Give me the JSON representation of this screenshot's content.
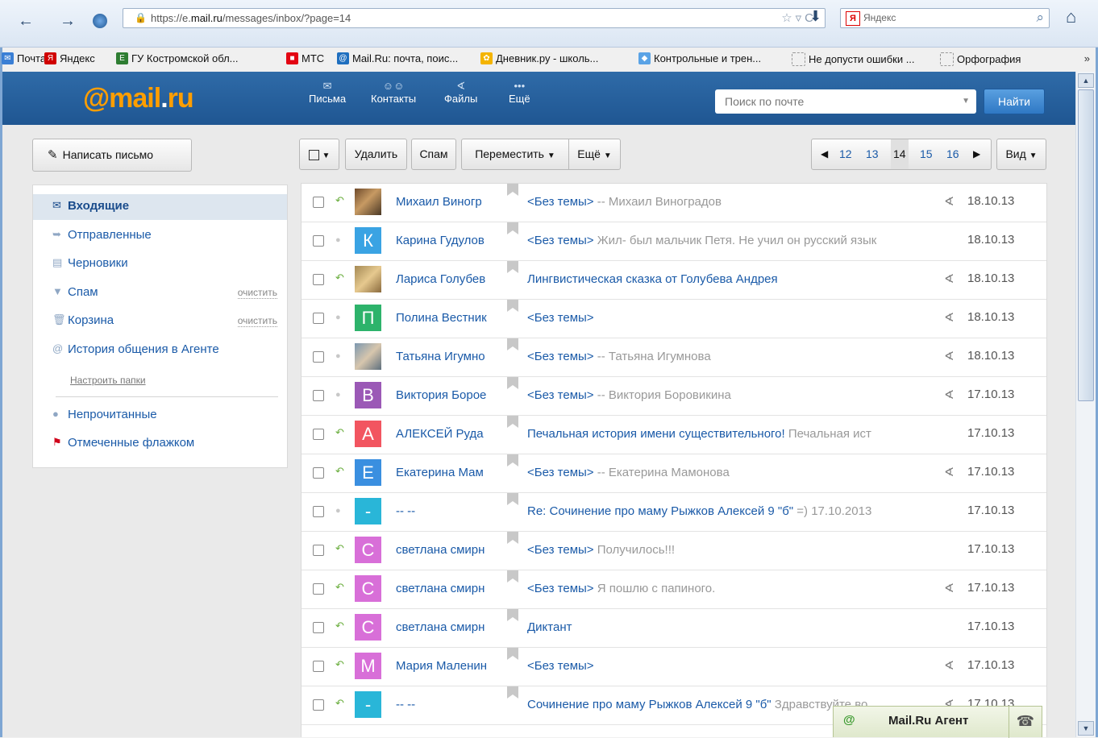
{
  "browser": {
    "url_prefix": "https://e.",
    "url_host": "mail.ru",
    "url_path": "/messages/inbox/?page=14",
    "search_engine_label": "Яндекс",
    "bookmarks": [
      {
        "label": "Почта",
        "icon": "mail-icon",
        "color": "#3a7fd5"
      },
      {
        "label": "Яндекс",
        "icon": "yandex-icon",
        "color": "#d00000"
      },
      {
        "label": "ГУ Костромской обл...",
        "icon": "ege-icon",
        "color": "#2e7d32"
      },
      {
        "label": "МТС",
        "icon": "mts-icon",
        "color": "#e30613"
      },
      {
        "label": "Mail.Ru: почта, поис...",
        "icon": "mailru-icon",
        "color": "#1f6fbf"
      },
      {
        "label": "Дневник.ру - школь...",
        "icon": "dnevnik-icon",
        "color": "#f4b400"
      },
      {
        "label": "Контрольные и трен...",
        "icon": "tests-icon",
        "color": "#5aa3e6"
      },
      {
        "label": "Не допусти ошибки ...",
        "icon": "page-icon",
        "color": "#999999"
      },
      {
        "label": "Орфография",
        "icon": "page-icon",
        "color": "#999999"
      }
    ],
    "more_label": "»"
  },
  "header": {
    "logo_at": "@",
    "logo_text": "mail",
    "logo_dot": ".",
    "logo_tld": "ru",
    "nav": [
      {
        "label": "Письма",
        "icon": "envelope-icon"
      },
      {
        "label": "Контакты",
        "icon": "contacts-icon"
      },
      {
        "label": "Файлы",
        "icon": "paperclip-icon"
      },
      {
        "label": "Ещё",
        "icon": "more-dots-icon"
      }
    ],
    "search_placeholder": "Поиск по почте",
    "search_button": "Найти"
  },
  "compose_label": "Написать письмо",
  "folders": [
    {
      "label": "Входящие",
      "icon": "envelope-icon",
      "action": ""
    },
    {
      "label": "Отправленные",
      "icon": "sent-icon",
      "action": ""
    },
    {
      "label": "Черновики",
      "icon": "draft-icon",
      "action": ""
    },
    {
      "label": "Спам",
      "icon": "thumbs-down-icon",
      "action": "очистить"
    },
    {
      "label": "Корзина",
      "icon": "trash-icon",
      "action": "очистить"
    },
    {
      "label": "История общения в Агенте",
      "icon": "at-icon",
      "action": ""
    }
  ],
  "setup_folders_label": "Настроить папки",
  "filters": [
    {
      "label": "Непрочитанные",
      "icon": "dot-icon"
    },
    {
      "label": "Отмеченные флажком",
      "icon": "flag-icon"
    }
  ],
  "toolbar": {
    "delete": "Удалить",
    "spam": "Спам",
    "move": "Переместить",
    "more": "Ещё",
    "view": "Вид"
  },
  "pager": {
    "pages": [
      "12",
      "13",
      "14",
      "15",
      "16"
    ],
    "current": "14"
  },
  "messages": [
    {
      "from": "Михаил Виногр",
      "subject": "<Без темы>",
      "snippet": " -- Михаил Виноградов",
      "date": "18.10.13",
      "attach": true,
      "status": "reply",
      "avatar": "photo",
      "letter": "",
      "color": ""
    },
    {
      "from": "Карина Гудулов",
      "subject": "<Без темы>",
      "snippet": " Жил- был мальчик Петя. Не учил он русский язык",
      "date": "18.10.13",
      "attach": false,
      "status": "dot",
      "avatar": "letter",
      "letter": "К",
      "color": "#3aa3e3"
    },
    {
      "from": "Лариса Голубев",
      "subject": "Лингвистическая сказка от Голубева Андрея",
      "snippet": "",
      "date": "18.10.13",
      "attach": true,
      "status": "reply",
      "avatar": "photo2",
      "letter": "",
      "color": ""
    },
    {
      "from": "Полина Вестник",
      "subject": "<Без темы>",
      "snippet": "",
      "date": "18.10.13",
      "attach": true,
      "status": "dot",
      "avatar": "letter",
      "letter": "П",
      "color": "#2db36b"
    },
    {
      "from": "Татьяна Игумно",
      "subject": "<Без темы>",
      "snippet": " -- Татьяна Игумнова",
      "date": "18.10.13",
      "attach": true,
      "status": "dot",
      "avatar": "photo3",
      "letter": "",
      "color": ""
    },
    {
      "from": "Виктория Борое",
      "subject": "<Без темы>",
      "snippet": " -- Виктория Боровикина",
      "date": "17.10.13",
      "attach": true,
      "status": "dot",
      "avatar": "letter",
      "letter": "В",
      "color": "#9b59b6"
    },
    {
      "from": "АЛЕКСЕЙ Руда",
      "subject": "Печальная история имени существительного!",
      "snippet": " Печальная ист",
      "date": "17.10.13",
      "attach": false,
      "status": "reply",
      "avatar": "letter",
      "letter": "А",
      "color": "#f25560"
    },
    {
      "from": "Екатерина Мам",
      "subject": "<Без темы>",
      "snippet": " -- Екатерина Мамонова",
      "date": "17.10.13",
      "attach": true,
      "status": "reply",
      "avatar": "letter",
      "letter": "Е",
      "color": "#3a8fe0"
    },
    {
      "from": "-- --",
      "subject": "Re: Сочинение про маму Рыжков Алексей 9 \"б\"",
      "snippet": " =) 17.10.2013",
      "date": "17.10.13",
      "attach": false,
      "status": "dot",
      "avatar": "letter",
      "letter": "-",
      "color": "#29b6d8"
    },
    {
      "from": "светлана смирн",
      "subject": "<Без темы>",
      "snippet": " Получилось!!!",
      "date": "17.10.13",
      "attach": false,
      "status": "reply",
      "avatar": "letter",
      "letter": "С",
      "color": "#d86fd8"
    },
    {
      "from": "светлана смирн",
      "subject": "<Без темы>",
      "snippet": " Я пошлю с папиного.",
      "date": "17.10.13",
      "attach": true,
      "status": "reply",
      "avatar": "letter",
      "letter": "С",
      "color": "#d86fd8"
    },
    {
      "from": "светлана смирн",
      "subject": "Диктант",
      "snippet": "",
      "date": "17.10.13",
      "attach": false,
      "status": "reply",
      "avatar": "letter",
      "letter": "С",
      "color": "#d86fd8"
    },
    {
      "from": "Мария Маленин",
      "subject": "<Без темы>",
      "snippet": "",
      "date": "17.10.13",
      "attach": true,
      "status": "reply",
      "avatar": "letter",
      "letter": "М",
      "color": "#d86fd8"
    },
    {
      "from": "-- --",
      "subject": "Сочинение про маму Рыжков Алексей 9 \"б\"",
      "snippet": " Здравствуйте во",
      "date": "17.10.13",
      "attach": true,
      "status": "reply",
      "avatar": "letter",
      "letter": "-",
      "color": "#29b6d8"
    }
  ],
  "agent": {
    "at": "@",
    "name": "Mail.Ru Агент"
  }
}
